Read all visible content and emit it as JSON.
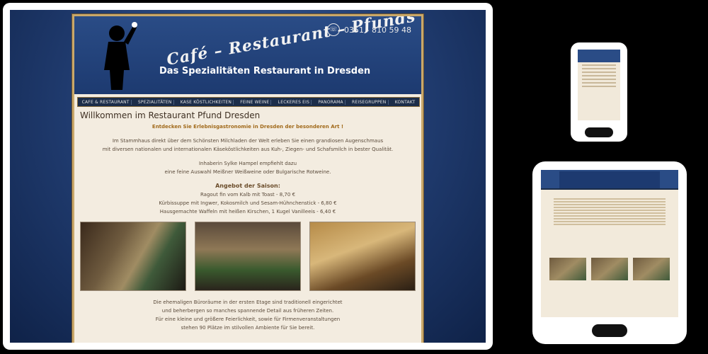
{
  "header": {
    "brand": "Café – Restaurant – Pfunds",
    "tagline": "Das Spezialitäten Restaurant in Dresden",
    "phone": "0351 - 810 59 48"
  },
  "nav": [
    "CAFE & RESTAURANT",
    "SPEZIALITÄTEN",
    "KASE KÖSTLICHKEITEN",
    "FEINE WEINE",
    "LECKERES EIS",
    "PANORAMA",
    "REISEGRUPPEN",
    "KONTAKT"
  ],
  "content": {
    "title": "Willkommen im Restaurant Pfund Dresden",
    "subtitle": "Entdecken Sie Erlebnisgastronomie in Dresden der besonderen Art !",
    "intro_1": "Im Stammhaus direkt über dem Schönsten Milchladen der Welt erleben Sie einen grandiosen Augenschmaus",
    "intro_2": "mit diversen nationalen und internationalen Käseköstlichkeiten aus Kuh-, Ziegen- und Schafsmilch in bester Qualität.",
    "owner_1": "Inhaberin Sylke Hampel empfiehlt dazu",
    "owner_2": "eine feine Auswahl Meißner Weißweine oder Bulgarische Rotweine.",
    "season_title": "Angebot der Saison:",
    "season_1": "Ragout fin vom Kalb mit Toast - 8,70 €",
    "season_2": "Kürbissuppe mit Ingwer, Kokosmilch und Sesam-Hühnchenstick - 6,80 €",
    "season_3": "Hausgemachte Waffeln mit heißen Kirschen, 1 Kugel Vanilleeis - 6,40 €",
    "outro_1": "Die ehemaligen Büroräume in der ersten Etage sind traditionell eingerichtet",
    "outro_2": "und beherbergen so manches spannende Detail aus früheren Zeiten.",
    "outro_3": "Für eine kleine und größere Feierlichkeit, sowie für Firmenveranstaltungen",
    "outro_4": "stehen 90 Plätze im stilvollen Ambiente für Sie bereit."
  }
}
